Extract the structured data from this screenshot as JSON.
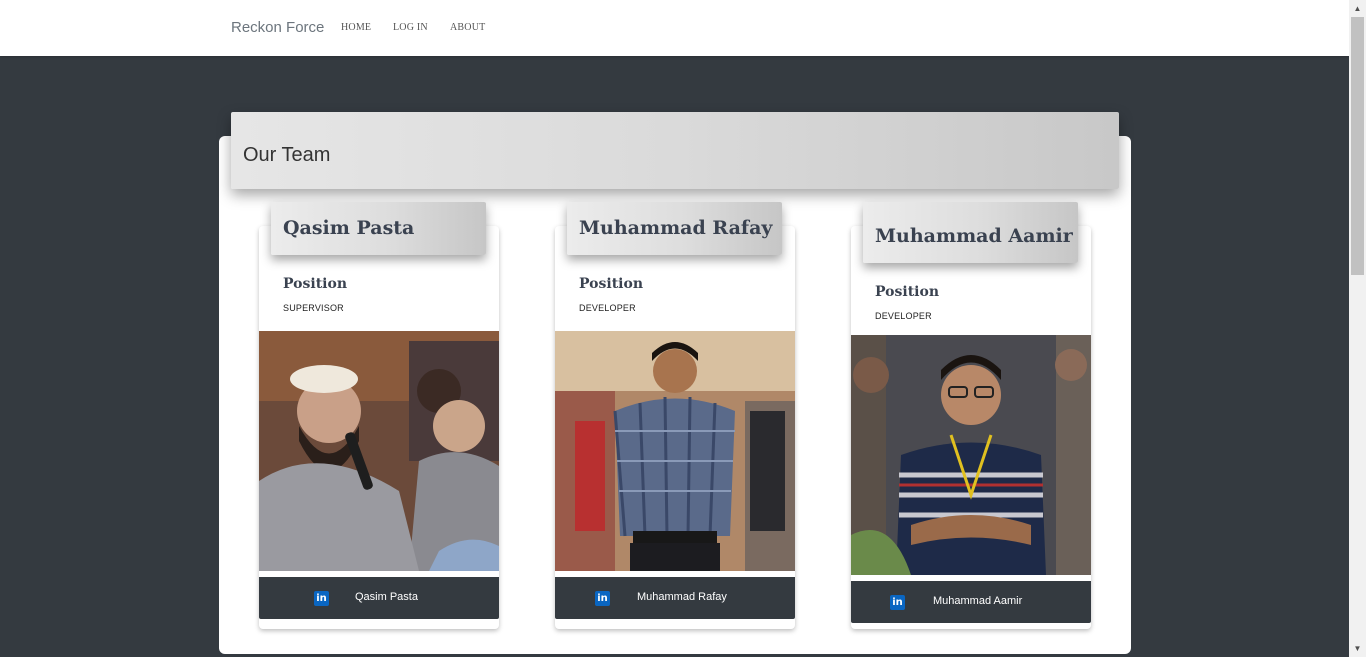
{
  "navbar": {
    "brand": "Reckon Force",
    "links": [
      "HOME",
      "LOG IN",
      "ABOUT"
    ]
  },
  "team": {
    "title": "Our Team",
    "position_label": "Position",
    "members": [
      {
        "name": "Qasim Pasta",
        "position": "SUPERVISOR",
        "linkedin_label": "Qasim Pasta"
      },
      {
        "name": "Muhammad Rafay",
        "position": "DEVELOPER",
        "linkedin_label": "Muhammad Rafay"
      },
      {
        "name": "Muhammad Aamir",
        "position": "DEVELOPER",
        "linkedin_label": "Muhammad Aamir"
      }
    ]
  },
  "icons": {
    "linkedin": "linkedin-icon",
    "linkedin_glyph": "in",
    "scroll_up": "▲",
    "scroll_down": "▼"
  },
  "colors": {
    "page_background": "#343a40",
    "footer_bar": "#343a40",
    "linkedin": "#0a66c2"
  }
}
